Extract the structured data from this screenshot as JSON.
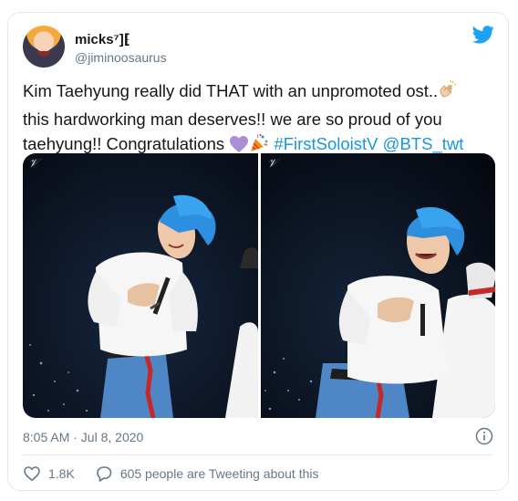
{
  "user": {
    "display_name": "micks⁷]⁅",
    "handle": "@jiminoosaurus"
  },
  "tweet": {
    "line1_text": "Kim Taehyung really did THAT with an unpromoted ost..",
    "line2_text": "this hardworking man deserves!! we are so proud of you",
    "line3_text": "taehyung!! Congratulations ",
    "hashtag": "#FirstSoloistV",
    "mention": "@BTS_twt",
    "emojis": [
      "clapping-hands",
      "purple-heart",
      "party-popper"
    ]
  },
  "media": {
    "watermark_left": "𝒱",
    "watermark_right": "𝒱"
  },
  "meta": {
    "timestamp": "8:05 AM · Jul 8, 2020"
  },
  "actions": {
    "likes": "1.8K",
    "conversation": "605 people are Tweeting about this"
  },
  "colors": {
    "link": "#1b95e0",
    "text": "#14171a",
    "muted": "#657786",
    "border": "#e1e8ed"
  }
}
